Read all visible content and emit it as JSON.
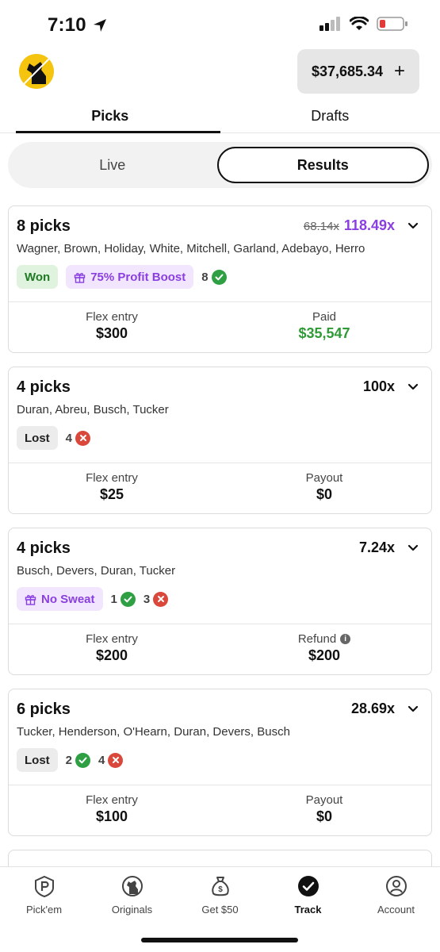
{
  "status": {
    "time": "7:10"
  },
  "header": {
    "balance": "$37,685.34",
    "add_label": "+"
  },
  "tabs": [
    {
      "label": "Picks",
      "active": true
    },
    {
      "label": "Drafts",
      "active": false
    }
  ],
  "segment": {
    "live_label": "Live",
    "results_label": "Results",
    "active": "Results"
  },
  "cards": [
    {
      "title": "8 picks",
      "multiplier_original": "68.14x",
      "multiplier": "118.49x",
      "players": "Wagner, Brown, Holiday, White, Mitchell, Garland, Adebayo, Herro",
      "status": "Won",
      "promo": "75% Profit Boost",
      "correct": "8",
      "entry_label": "Flex entry",
      "entry_value": "$300",
      "result_label": "Paid",
      "result_value": "$35,547"
    },
    {
      "title": "4 picks",
      "multiplier": "100x",
      "players": "Duran, Abreu, Busch, Tucker",
      "status": "Lost",
      "incorrect": "4",
      "entry_label": "Flex entry",
      "entry_value": "$25",
      "result_label": "Payout",
      "result_value": "$0"
    },
    {
      "title": "4 picks",
      "multiplier": "7.24x",
      "players": "Busch, Devers, Duran, Tucker",
      "promo": "No Sweat",
      "correct": "1",
      "incorrect": "3",
      "entry_label": "Flex entry",
      "entry_value": "$200",
      "result_label": "Refund",
      "result_value": "$200"
    },
    {
      "title": "6 picks",
      "multiplier": "28.69x",
      "players": "Tucker, Henderson, O'Hearn, Duran, Devers, Busch",
      "status": "Lost",
      "correct": "2",
      "incorrect": "4",
      "entry_label": "Flex entry",
      "entry_value": "$100",
      "result_label": "Payout",
      "result_value": "$0"
    }
  ],
  "bottom_nav": [
    {
      "label": "Pick'em",
      "icon": "pickem-icon"
    },
    {
      "label": "Originals",
      "icon": "originals-icon"
    },
    {
      "label": "Get $50",
      "icon": "money-bag-icon"
    },
    {
      "label": "Track",
      "icon": "check-circle-icon",
      "active": true
    },
    {
      "label": "Account",
      "icon": "account-icon"
    }
  ],
  "colors": {
    "won": "#2f9a36",
    "boost": "#8a3fe0",
    "lost": "#d9483b"
  }
}
